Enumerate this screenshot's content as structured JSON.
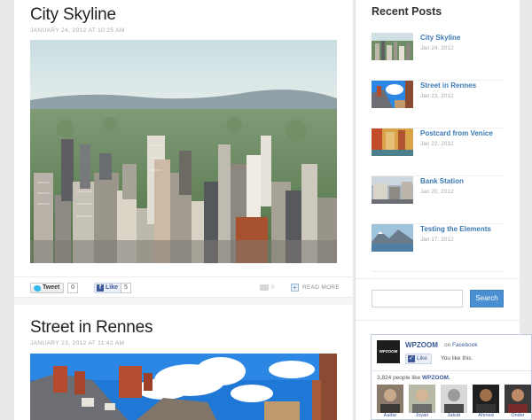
{
  "posts": [
    {
      "title": "City Skyline",
      "date": "JANUARY 24, 2012 AT 10:25 AM"
    },
    {
      "title": "Street in Rennes",
      "date": "JANUARY 23, 2012 AT 11:42 AM"
    }
  ],
  "share": {
    "tweet_label": "Tweet",
    "tweet_count": "0",
    "like_label": "Like",
    "like_count": "5",
    "comment_count": "0",
    "read_more": "READ MORE"
  },
  "sidebar": {
    "recent_heading": "Recent Posts",
    "recent": [
      {
        "title": "City Skyline",
        "date": "Jan 24, 2012"
      },
      {
        "title": "Street in Rennes",
        "date": "Jan 23, 2012"
      },
      {
        "title": "Postcard from Venice",
        "date": "Jan 22, 2012"
      },
      {
        "title": "Bank Station",
        "date": "Jan 20, 2012"
      },
      {
        "title": "Testing the Elements",
        "date": "Jan 17, 2012"
      }
    ],
    "search_button": "Search"
  },
  "facebook": {
    "logo_text": "WPZOOM",
    "page_name": "WPZOOM",
    "on_prefix": "on",
    "network": "Facebook",
    "like_label": "Like",
    "you_like": "You like this.",
    "count_prefix": "3,824 people like",
    "count_page": "WPZOOM.",
    "faces": [
      "Aadar",
      "Joyan",
      "Jakub",
      "Ahmed",
      "Onder"
    ]
  },
  "colors": {
    "link": "#3b7ab5",
    "search_button": "#4a8fd1",
    "facebook": "#3b5998"
  }
}
